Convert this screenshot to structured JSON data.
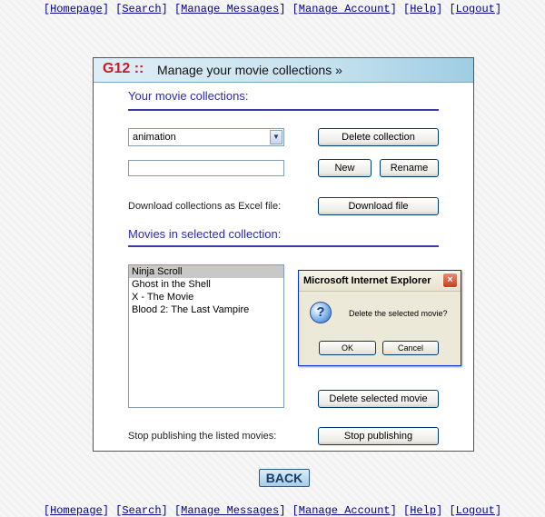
{
  "nav": [
    {
      "label": "Homepage"
    },
    {
      "label": "Search"
    },
    {
      "label": "Manage Messages"
    },
    {
      "label": "Manage Account"
    },
    {
      "label": "Help"
    },
    {
      "label": "Logout"
    }
  ],
  "panel": {
    "logo": "G12 ::",
    "title": "Manage your movie collections »"
  },
  "collections": {
    "heading": "Your movie collections:",
    "selected": "animation",
    "new_name_value": "",
    "delete_label": "Delete collection",
    "new_label": "New",
    "rename_label": "Rename",
    "download_text": "Download collections as Excel file:",
    "download_label": "Download file"
  },
  "movies": {
    "heading": "Movies in selected collection:",
    "items": [
      "Ninja Scroll",
      "Ghost in the Shell",
      "X - The Movie",
      "Blood 2: The Last Vampire"
    ],
    "delete_selected_label": "Delete selected movie",
    "stop_text": "Stop publishing the listed movies:",
    "stop_label": "Stop publishing"
  },
  "dialog": {
    "title": "Microsoft Internet Explorer",
    "message": "Delete the selected movie?",
    "ok_label": "OK",
    "cancel_label": "Cancel",
    "icon": "question-icon",
    "close": "×"
  },
  "back_label": "BACK",
  "colors": {
    "nav_link": "#00008b",
    "logo": "#c81e1e",
    "section_heading": "#2a2ab8"
  }
}
